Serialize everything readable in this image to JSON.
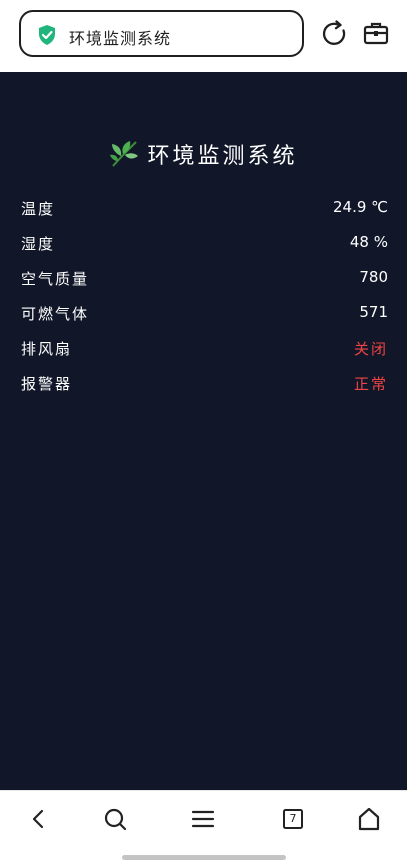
{
  "browser": {
    "address_text": "环境监测系统",
    "tab_count": "7"
  },
  "page": {
    "title": "环境监测系统",
    "rows": [
      {
        "label": "温度",
        "value": "24.9 ℃"
      },
      {
        "label": "湿度",
        "value": "48 %"
      },
      {
        "label": "空气质量",
        "value": "780"
      },
      {
        "label": "可燃气体",
        "value": "571"
      },
      {
        "label": "排风扇",
        "value": "关闭"
      },
      {
        "label": "报警器",
        "value": "正常"
      }
    ]
  },
  "colors": {
    "background": "#111729",
    "alert": "#ef4444",
    "secure": "#1fb57c"
  }
}
